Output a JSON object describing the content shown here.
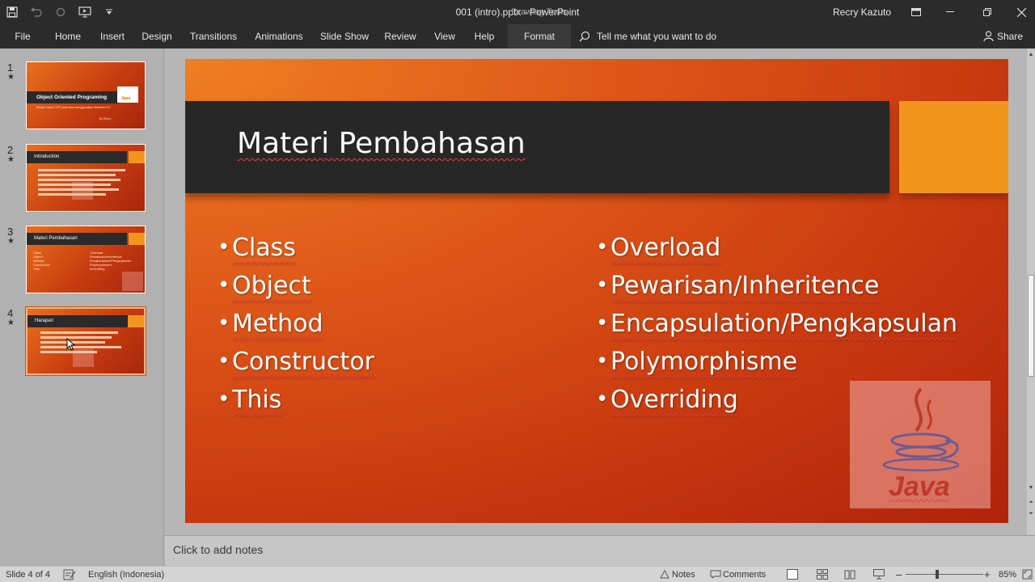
{
  "titlebar": {
    "document_title": "001 (intro).pptx  -  PowerPoint",
    "context_tools": "Drawing Tools",
    "user": "Recry Kazuto"
  },
  "ribbon": {
    "tabs": [
      "File",
      "Home",
      "Insert",
      "Design",
      "Transitions",
      "Animations",
      "Slide Show",
      "Review",
      "View",
      "Help",
      "Format"
    ],
    "tell_me": "Tell me what you want to do",
    "share": "Share"
  },
  "thumbnails": [
    {
      "number": "1",
      "title": "Object Oriented Programing",
      "subtitle": "Belajar Dasar OOP pada Java menggunakan Netbeans 8.2",
      "author": "By Recry"
    },
    {
      "number": "2",
      "title": "Introduction"
    },
    {
      "number": "3",
      "title": "Materi Pembahasan",
      "left_items": [
        "Class",
        "Object",
        "Method",
        "Constructor",
        "This"
      ],
      "right_items": [
        "Overload",
        "Pewarisan/Inheritence",
        "Encapsulation/Pengkapsulan",
        "Polymorphisme",
        "Overriding"
      ]
    },
    {
      "number": "4",
      "title": "Harapan"
    }
  ],
  "slide": {
    "title": "Materi Pembahasan",
    "left_bullets": [
      "Class",
      "Object",
      "Method",
      "Constructor",
      "This"
    ],
    "right_bullets": [
      "Overload",
      "Pewarisan/Inheritence",
      "Encapsulation/Pengkapsulan",
      "Polymorphisme",
      "Overriding"
    ],
    "logo_text": "Java"
  },
  "notes": {
    "placeholder": "Click to add notes"
  },
  "status": {
    "slide_info": "Slide 4 of 4",
    "language": "English (Indonesia)",
    "notes_label": "Notes",
    "comments_label": "Comments",
    "zoom": "85%"
  },
  "colors": {
    "title_band": "#272727",
    "accent": "#f2951d",
    "slide_orange": "#de5618",
    "chrome": "#2b2b2b"
  }
}
